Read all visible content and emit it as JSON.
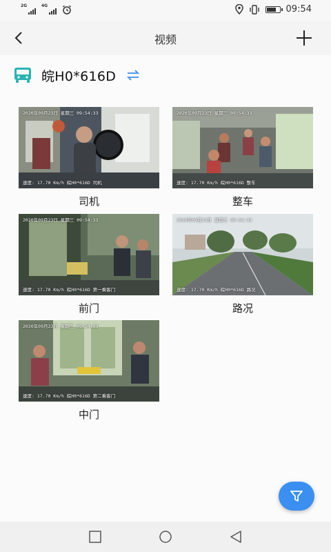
{
  "status_bar": {
    "signal_1": "2G",
    "signal_2": "4G",
    "time": "09:54",
    "battery_level": 0.85
  },
  "header": {
    "title": "视频",
    "back_icon": "chevron-left-icon",
    "add_icon": "plus-icon"
  },
  "vehicle": {
    "icon": "bus-icon",
    "plate": "皖H0*616D",
    "swap_icon": "swap-arrows-icon",
    "icon_color": "#2bb3b3",
    "swap_color": "#3a8ff0"
  },
  "cameras": [
    {
      "label": "司机",
      "osd_top": "2020年09月23日 星期三 09:54:33",
      "osd_bottom": "速度: 17.70 Km/h  皖H0*616D  司机"
    },
    {
      "label": "整车",
      "osd_top": "2020年09月23日 星期三 09:54:33",
      "osd_bottom": "速度: 17.70 Km/h  皖H0*616D  整车"
    },
    {
      "label": "前门",
      "osd_top": "2020年09月23日 星期三 09:54:33",
      "osd_bottom": "速度: 17.70 Km/h  皖H0*616D  第一乘客门"
    },
    {
      "label": "路况",
      "osd_top": "2020年09月23日 星期三 09:54:33",
      "osd_bottom": "速度: 17.70 Km/h  皖H0*616D  路况"
    },
    {
      "label": "中门",
      "osd_top": "2020年09月23日 星期三 09:54:33",
      "osd_bottom": "速度: 17.70 Km/h  皖H0*616D  第二乘客门"
    }
  ],
  "filter_button": {
    "icon": "filter-icon",
    "color": "#3a8ff0"
  },
  "nav_bar": {
    "recents_icon": "square-icon",
    "home_icon": "circle-icon",
    "back_icon": "triangle-back-icon"
  }
}
